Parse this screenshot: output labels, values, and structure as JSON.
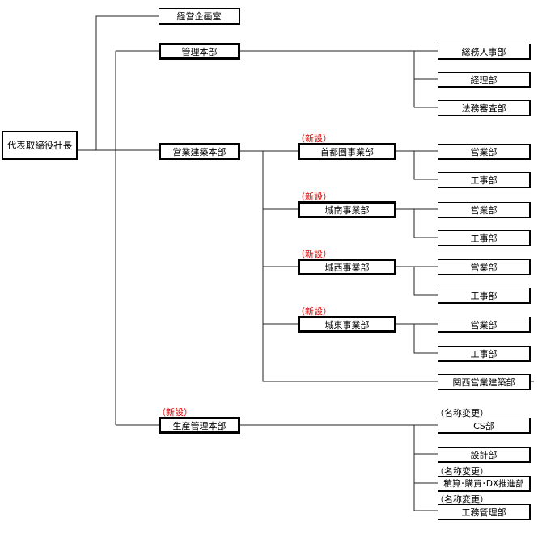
{
  "ceo": "代表取締役社長",
  "direct": [
    "経営企画室"
  ],
  "hq": [
    {
      "name": "管理本部",
      "depts": [
        "総務人事部",
        "経理部",
        "法務審査部"
      ]
    },
    {
      "name": "営業建築本部",
      "divisions": [
        {
          "name": "首都圏事業部",
          "note": "（新設）",
          "depts": [
            "営業部",
            "工事部"
          ]
        },
        {
          "name": "城南事業部",
          "note": "（新設）",
          "depts": [
            "営業部",
            "工事部"
          ]
        },
        {
          "name": "城西事業部",
          "note": "（新設）",
          "depts": [
            "営業部",
            "工事部"
          ]
        },
        {
          "name": "城東事業部",
          "note": "（新設）",
          "depts": [
            "営業部",
            "工事部"
          ]
        }
      ],
      "extra": "関西営業建築部"
    },
    {
      "name": "生産管理本部",
      "note": "（新設）",
      "depts": [
        {
          "name": "CS部",
          "note": "（名称変更）"
        },
        {
          "name": "設計部"
        },
        {
          "name": "積算･購買･DX推進部",
          "note": "（名称変更）"
        },
        {
          "name": "工務管理部",
          "note": "（名称変更）"
        }
      ]
    }
  ],
  "colors": {
    "new_label": "#e00000",
    "lines": "#000000"
  }
}
